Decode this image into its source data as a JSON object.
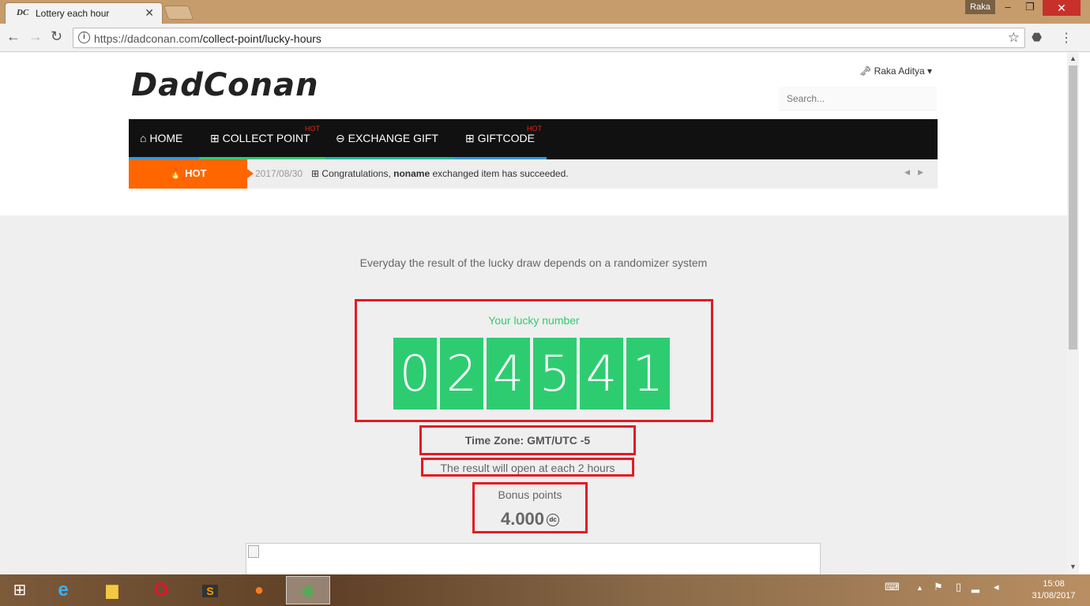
{
  "browser": {
    "tab_title": "Lottery each hour",
    "tab_favicon": "DC",
    "user_chip": "Raka",
    "url_host": "https://dadconan.com",
    "url_path": "/collect-point/lucky-hours"
  },
  "site": {
    "logo": "DadConan",
    "user_name": "Raka Aditya",
    "search_placeholder": "Search..."
  },
  "nav": {
    "items": [
      {
        "label": "HOME",
        "icon": "home-icon",
        "bar_color": "#3498db",
        "hot": ""
      },
      {
        "label": "COLLECT POINT",
        "icon": "gift-icon",
        "bar_color": "#2ecc71",
        "hot": "HOT"
      },
      {
        "label": "EXCHANGE GIFT",
        "icon": "gamepad-icon",
        "bar_color": "#1abc9c",
        "hot": ""
      },
      {
        "label": "GIFTCODE",
        "icon": "gift-icon",
        "bar_color": "#3498db",
        "hot": "HOT"
      }
    ]
  },
  "ticker": {
    "badge": "HOT",
    "date": "2017/08/30",
    "prefix": "Congratulations,",
    "user": "noname",
    "suffix": "exchanged item has succeeded."
  },
  "lottery": {
    "intro": "Everyday the result of the lucky draw depends on a randomizer system",
    "lucky_title": "Your lucky number",
    "digits": [
      "0",
      "2",
      "4",
      "5",
      "4",
      "1"
    ],
    "timezone": "Time Zone: GMT/UTC -5",
    "result_note": "The result will open at each 2 hours",
    "bonus_label": "Bonus points",
    "bonus_value": "4.000"
  },
  "taskbar": {
    "time": "15:08",
    "date": "31/08/2017"
  },
  "colors": {
    "accent_green": "#2ecc71",
    "hot_orange": "#ff6600",
    "highlight_red": "#e31b23"
  }
}
